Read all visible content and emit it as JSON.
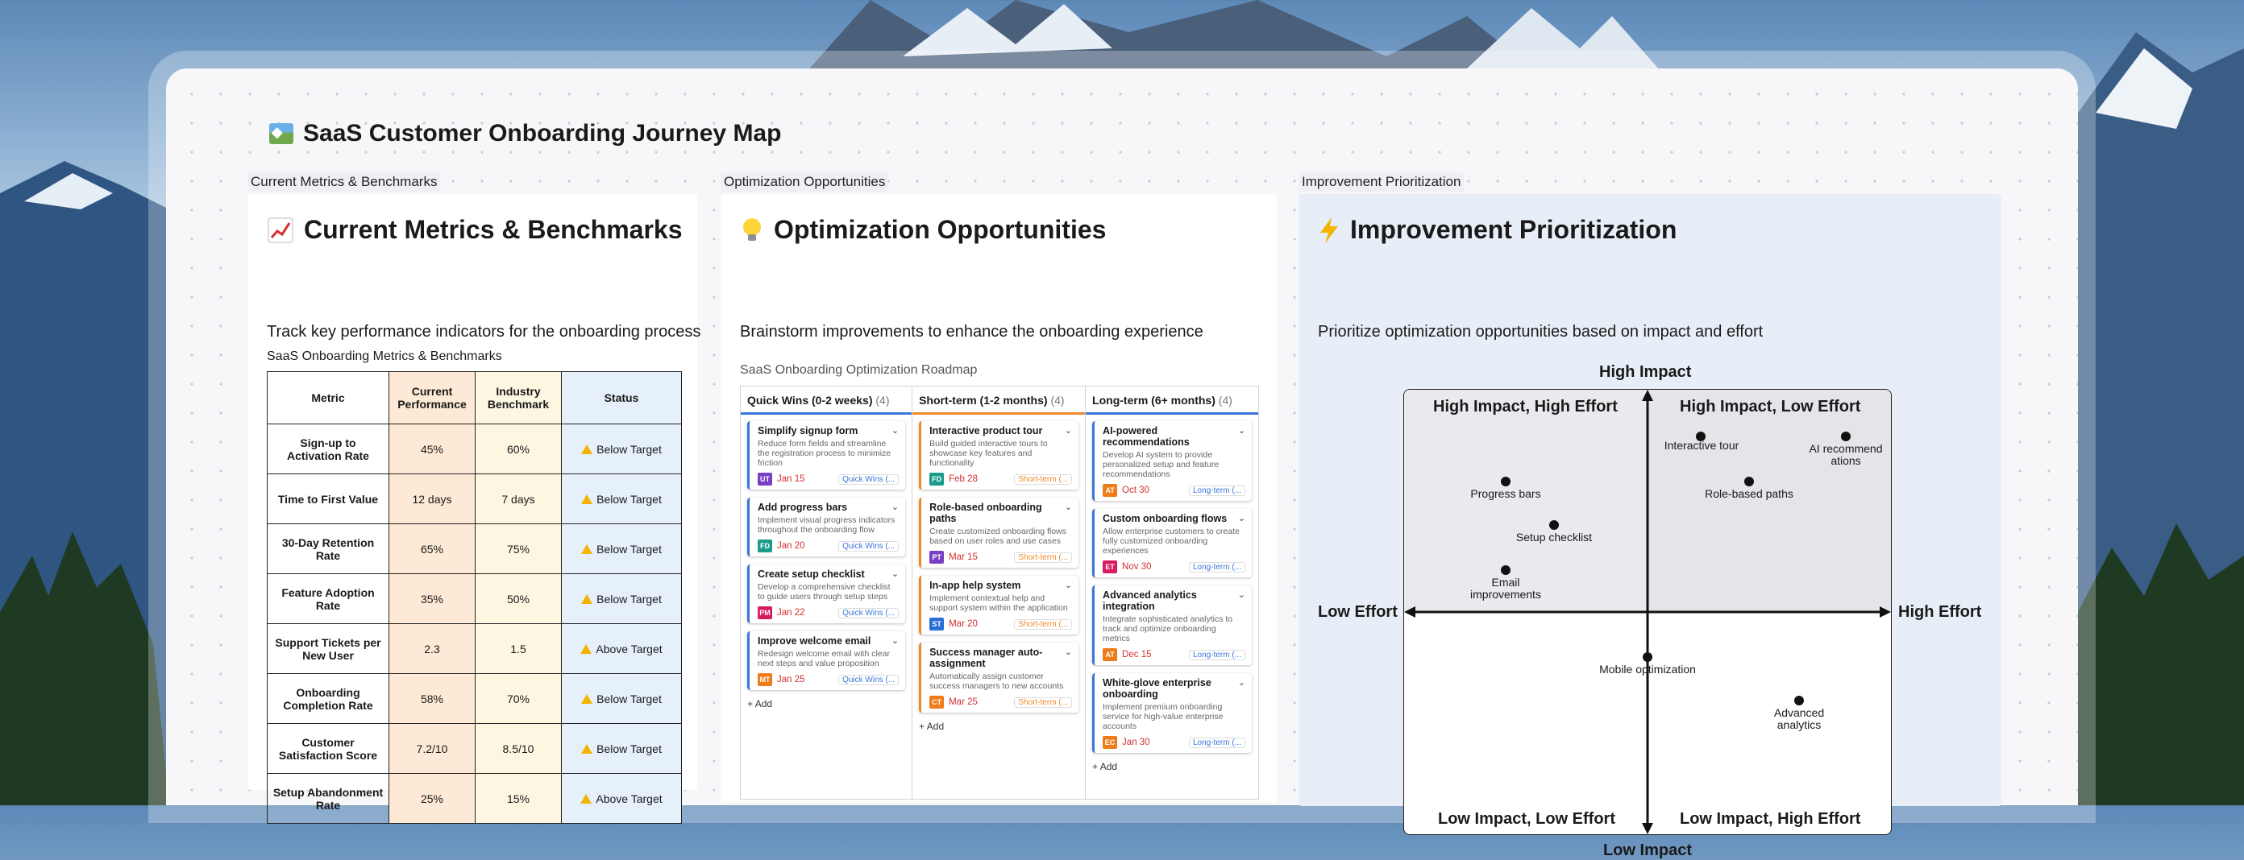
{
  "board": {
    "title": "SaaS Customer Onboarding Journey Map",
    "icon": "map-icon"
  },
  "frames": {
    "metrics": {
      "tab_label": "Current Metrics & Benchmarks",
      "title": "Current Metrics & Benchmarks",
      "icon": "chart-increasing-icon",
      "subtitle": "Track key performance indicators for the onboarding process",
      "table_caption": "SaaS Onboarding Metrics & Benchmarks",
      "headers": [
        "Metric",
        "Current Performance",
        "Industry Benchmark",
        "Status"
      ],
      "rows": [
        {
          "metric": "Sign-up to Activation Rate",
          "current": "45%",
          "benchmark": "60%",
          "status": "Below Target"
        },
        {
          "metric": "Time to First Value",
          "current": "12 days",
          "benchmark": "7 days",
          "status": "Below Target"
        },
        {
          "metric": "30-Day Retention Rate",
          "current": "65%",
          "benchmark": "75%",
          "status": "Below Target"
        },
        {
          "metric": "Feature Adoption Rate",
          "current": "35%",
          "benchmark": "50%",
          "status": "Below Target"
        },
        {
          "metric": "Support Tickets per New User",
          "current": "2.3",
          "benchmark": "1.5",
          "status": "Above Target"
        },
        {
          "metric": "Onboarding Completion Rate",
          "current": "58%",
          "benchmark": "70%",
          "status": "Below Target"
        },
        {
          "metric": "Customer Satisfaction Score",
          "current": "7.2/10",
          "benchmark": "8.5/10",
          "status": "Below Target"
        },
        {
          "metric": "Setup Abandonment Rate",
          "current": "25%",
          "benchmark": "15%",
          "status": "Above Target"
        }
      ]
    },
    "optimization": {
      "tab_label": "Optimization Opportunities",
      "title": "Optimization Opportunities",
      "icon": "light-bulb-icon",
      "subtitle": "Brainstorm improvements to enhance the onboarding experience",
      "roadmap_caption": "SaaS Onboarding Optimization Roadmap",
      "add_label": "Add",
      "columns": [
        {
          "name": "Quick Wins (0-2 weeks)",
          "count": "(4)",
          "color": "#3a76d8",
          "cards": [
            {
              "title": "Simplify signup form",
              "desc": "Reduce form fields and streamline the registration process to minimize friction",
              "avatar": "UT",
              "avatar_color": "#7b3fc4",
              "date": "Jan 15",
              "tag": "Quick Wins (..."
            },
            {
              "title": "Add progress bars",
              "desc": "Implement visual progress indicators throughout the onboarding flow",
              "avatar": "FD",
              "avatar_color": "#1a9c8c",
              "date": "Jan 20",
              "tag": "Quick Wins (..."
            },
            {
              "title": "Create setup checklist",
              "desc": "Develop a comprehensive checklist to guide users through setup steps",
              "avatar": "PM",
              "avatar_color": "#d81b60",
              "date": "Jan 22",
              "tag": "Quick Wins (..."
            },
            {
              "title": "Improve welcome email",
              "desc": "Redesign welcome email with clear next steps and value proposition",
              "avatar": "MT",
              "avatar_color": "#ef7c1a",
              "date": "Jan 25",
              "tag": "Quick Wins (..."
            }
          ]
        },
        {
          "name": "Short-term (1-2 months)",
          "count": "(4)",
          "color": "#ef8a2a",
          "cards": [
            {
              "title": "Interactive product tour",
              "desc": "Build guided interactive tours to showcase key features and functionality",
              "avatar": "FD",
              "avatar_color": "#1a9c8c",
              "date": "Feb 28",
              "tag": "Short-term (..."
            },
            {
              "title": "Role-based onboarding paths",
              "desc": "Create customized onboarding flows based on user roles and use cases",
              "avatar": "PT",
              "avatar_color": "#7b3fc4",
              "date": "Mar 15",
              "tag": "Short-term (..."
            },
            {
              "title": "In-app help system",
              "desc": "Implement contextual help and support system within the application",
              "avatar": "ST",
              "avatar_color": "#2a6fd8",
              "date": "Mar 20",
              "tag": "Short-term (..."
            },
            {
              "title": "Success manager auto-assignment",
              "desc": "Automatically assign customer success managers to new accounts",
              "avatar": "CT",
              "avatar_color": "#ef7c1a",
              "date": "Mar 25",
              "tag": "Short-term (..."
            }
          ]
        },
        {
          "name": "Long-term (6+ months)",
          "count": "(4)",
          "color": "#3a76d8",
          "cards": [
            {
              "title": "AI-powered recommendations",
              "desc": "Develop AI system to provide personalized setup and feature recommendations",
              "avatar": "AT",
              "avatar_color": "#ef7c1a",
              "date": "Oct 30",
              "tag": "Long-term (..."
            },
            {
              "title": "Custom onboarding flows",
              "desc": "Allow enterprise customers to create fully customized onboarding experiences",
              "avatar": "ET",
              "avatar_color": "#d81b60",
              "date": "Nov 30",
              "tag": "Long-term (..."
            },
            {
              "title": "Advanced analytics integration",
              "desc": "Integrate sophisticated analytics to track and optimize onboarding metrics",
              "avatar": "AT",
              "avatar_color": "#ef7c1a",
              "date": "Dec 15",
              "tag": "Long-term (..."
            },
            {
              "title": "White-glove enterprise onboarding",
              "desc": "Implement premium onboarding service for high-value enterprise accounts",
              "avatar": "EC",
              "avatar_color": "#ef7c1a",
              "date": "Jan 30",
              "tag": "Long-term (..."
            }
          ]
        }
      ]
    },
    "prioritization": {
      "tab_label": "Improvement Prioritization",
      "title": "Improvement Prioritization",
      "icon": "lightning-icon",
      "subtitle": "Prioritize optimization opportunities based on impact and effort",
      "axis": {
        "top": "High Impact",
        "bottom": "Low Impact",
        "left": "Low Effort",
        "right": "High Effort"
      },
      "quadrants": {
        "tl": "High Impact, High Effort",
        "tr": "High Impact, Low Effort",
        "bl": "Low Impact, Low Effort",
        "br": "Low Impact, High Effort"
      },
      "items": [
        {
          "label": "Interactive tour"
        },
        {
          "label": "AI recommend ations"
        },
        {
          "label": "Role-based paths"
        },
        {
          "label": "Progress bars"
        },
        {
          "label": "Setup checklist"
        },
        {
          "label": "Email improvements"
        },
        {
          "label": "Mobile optimization"
        },
        {
          "label": "Advanced analytics"
        }
      ]
    }
  }
}
